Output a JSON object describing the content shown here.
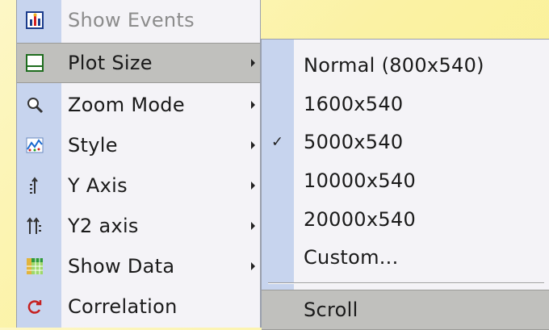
{
  "main_menu": {
    "items": [
      {
        "label": "Show Events",
        "icon": "events-chart-icon",
        "disabled": true,
        "submenu": false
      },
      {
        "label": "Plot Size",
        "icon": "plot-size-icon",
        "disabled": false,
        "submenu": true,
        "highlighted": true
      },
      {
        "label": "Zoom Mode",
        "icon": "magnifier-icon",
        "disabled": false,
        "submenu": true
      },
      {
        "label": "Style",
        "icon": "style-icon",
        "disabled": false,
        "submenu": true
      },
      {
        "label": "Y Axis",
        "icon": "y-axis-icon",
        "disabled": false,
        "submenu": true
      },
      {
        "label": "Y2 axis",
        "icon": "y2-axis-icon",
        "disabled": false,
        "submenu": true
      },
      {
        "label": "Show Data",
        "icon": "data-grid-icon",
        "disabled": false,
        "submenu": true
      },
      {
        "label": "Correlation",
        "icon": "correlation-icon",
        "disabled": false,
        "submenu": false
      }
    ]
  },
  "submenu": {
    "items": [
      {
        "label": "Normal (800x540)",
        "checked": false
      },
      {
        "label": "1600x540",
        "checked": false
      },
      {
        "label": "5000x540",
        "checked": true
      },
      {
        "label": "10000x540",
        "checked": false
      },
      {
        "label": "20000x540",
        "checked": false
      },
      {
        "label": "Custom...",
        "checked": false
      }
    ],
    "scroll_label": "Scroll",
    "check_glyph": "✓"
  },
  "colors": {
    "gutter": "#c7d4ee",
    "menu_bg": "#f4f3f7",
    "highlight": "#c0c0bd",
    "background": "#faf08f"
  }
}
